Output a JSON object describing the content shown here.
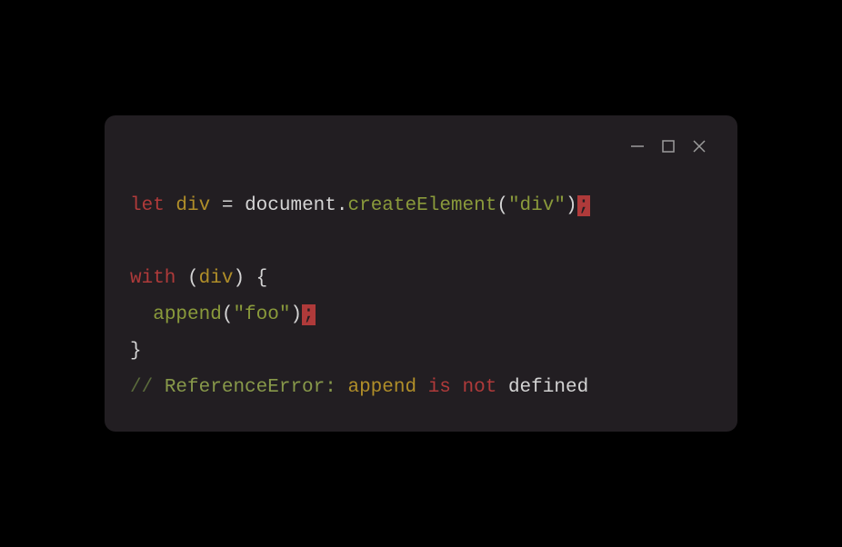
{
  "window": {
    "controls": {
      "minimize": "minimize",
      "maximize": "maximize",
      "close": "close"
    }
  },
  "code": {
    "lines": [
      {
        "tokens": [
          {
            "text": "let",
            "class": "keyword"
          },
          {
            "text": " ",
            "class": ""
          },
          {
            "text": "div",
            "class": "var"
          },
          {
            "text": " ",
            "class": ""
          },
          {
            "text": "=",
            "class": "punct"
          },
          {
            "text": " ",
            "class": ""
          },
          {
            "text": "document",
            "class": "object"
          },
          {
            "text": ".",
            "class": "punct"
          },
          {
            "text": "createElement",
            "class": "method"
          },
          {
            "text": "(",
            "class": "punct"
          },
          {
            "text": "\"div\"",
            "class": "string"
          },
          {
            "text": ")",
            "class": "punct"
          },
          {
            "text": ";",
            "class": "err-semi"
          }
        ]
      },
      {
        "tokens": []
      },
      {
        "tokens": [
          {
            "text": "with",
            "class": "keyword"
          },
          {
            "text": " (",
            "class": "punct"
          },
          {
            "text": "div",
            "class": "var"
          },
          {
            "text": ") {",
            "class": "punct"
          }
        ]
      },
      {
        "tokens": [
          {
            "text": "  ",
            "class": ""
          },
          {
            "text": "append",
            "class": "method"
          },
          {
            "text": "(",
            "class": "punct"
          },
          {
            "text": "\"foo\"",
            "class": "string"
          },
          {
            "text": ")",
            "class": "punct"
          },
          {
            "text": ";",
            "class": "err-semi"
          }
        ]
      },
      {
        "tokens": [
          {
            "text": "}",
            "class": "punct"
          }
        ]
      },
      {
        "tokens": [
          {
            "text": "//",
            "class": "comment-slash"
          },
          {
            "text": " ",
            "class": ""
          },
          {
            "text": "ReferenceError:",
            "class": "comment-word1"
          },
          {
            "text": " ",
            "class": ""
          },
          {
            "text": "append",
            "class": "comment-word2"
          },
          {
            "text": " ",
            "class": ""
          },
          {
            "text": "is",
            "class": "comment-word3"
          },
          {
            "text": " ",
            "class": ""
          },
          {
            "text": "not",
            "class": "comment-word3"
          },
          {
            "text": " ",
            "class": ""
          },
          {
            "text": "defined",
            "class": "comment-word4"
          }
        ]
      }
    ]
  }
}
